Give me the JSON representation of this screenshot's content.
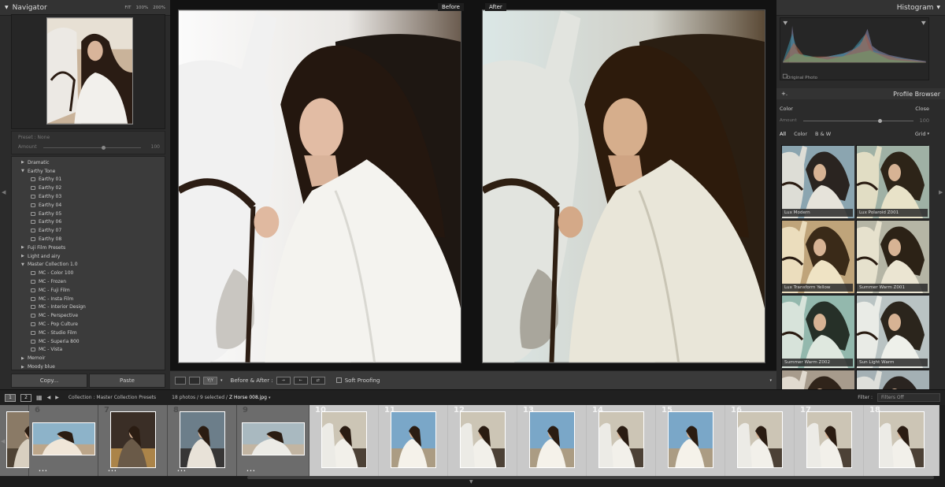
{
  "left_panel": {
    "navigator_title": "Navigator",
    "zoom_options": [
      "FIT",
      "100%",
      "200%"
    ],
    "preset_label": "Preset : None",
    "amount_label": "Amount",
    "amount_value": "100",
    "amount_fraction": 0.6,
    "presets": [
      {
        "label": "Dramatic",
        "kind": "folder",
        "open": false
      },
      {
        "label": "Earthy Tone",
        "kind": "folder",
        "open": true
      },
      {
        "label": "Earthy 01",
        "kind": "preset"
      },
      {
        "label": "Earthy 02",
        "kind": "preset"
      },
      {
        "label": "Earthy 03",
        "kind": "preset"
      },
      {
        "label": "Earthy 04",
        "kind": "preset"
      },
      {
        "label": "Earthy 05",
        "kind": "preset"
      },
      {
        "label": "Earthy 06",
        "kind": "preset"
      },
      {
        "label": "Earthy 07",
        "kind": "preset"
      },
      {
        "label": "Earthy 08",
        "kind": "preset"
      },
      {
        "label": "Fuji Film Presets",
        "kind": "folder",
        "open": false
      },
      {
        "label": "Light and airy",
        "kind": "folder",
        "open": false
      },
      {
        "label": "Master Collection 1.0",
        "kind": "folder",
        "open": true
      },
      {
        "label": "MC - Color 100",
        "kind": "preset"
      },
      {
        "label": "MC - Frozen",
        "kind": "preset"
      },
      {
        "label": "MC - Fuji Film",
        "kind": "preset"
      },
      {
        "label": "MC - Insta Film",
        "kind": "preset"
      },
      {
        "label": "MC - Interior Design",
        "kind": "preset"
      },
      {
        "label": "MC - Perspective",
        "kind": "preset"
      },
      {
        "label": "MC - Pop Culture",
        "kind": "preset"
      },
      {
        "label": "MC - Studio Film",
        "kind": "preset"
      },
      {
        "label": "MC - Superia 800",
        "kind": "preset"
      },
      {
        "label": "MC - Vista",
        "kind": "preset"
      },
      {
        "label": "Memoir",
        "kind": "folder",
        "open": false
      },
      {
        "label": "Moody blue",
        "kind": "folder",
        "open": false
      }
    ],
    "copy_label": "Copy...",
    "paste_label": "Paste"
  },
  "center": {
    "before_label": "Before",
    "after_label": "After",
    "toolbar": {
      "before_after_label": "Before & After :",
      "soft_proofing_label": "Soft Proofing",
      "yy_label": "Y|Y"
    }
  },
  "right_panel": {
    "histogram_title": "Histogram",
    "original_photo_label": "Original Photo",
    "profile_browser_title": "Profile Browser",
    "plus_label": "+.",
    "color_label": "Color",
    "close_label": "Close",
    "amount_label": "Amount",
    "amount_value": "100",
    "amount_fraction": 0.68,
    "filters": [
      "All",
      "Color",
      "B & W"
    ],
    "grid_label": "Grid",
    "profiles": [
      "Lux Modern",
      "Lux Polaroid Z001",
      "Lux Transform Yellow",
      "Summer Warm Z001",
      "Summer Warm Z002",
      "Sun Light Warm",
      "",
      ""
    ]
  },
  "filmstrip_bar": {
    "monitors": [
      "1",
      "2"
    ],
    "collection_text": "Collection : Master Collection Presets",
    "count_text": "18 photos / 9 selected /",
    "filename": "Z Horse 008.jpg",
    "filter_label": "Filter :",
    "filter_value": "Filters Off"
  },
  "filmstrip": [
    {
      "num": "",
      "selected": false,
      "scene": "street"
    },
    {
      "num": "6",
      "selected": false,
      "scene": "picnic"
    },
    {
      "num": "7",
      "selected": false,
      "scene": "night"
    },
    {
      "num": "8",
      "selected": false,
      "scene": "couple"
    },
    {
      "num": "9",
      "selected": false,
      "scene": "car"
    },
    {
      "num": "10",
      "selected": true,
      "scene": "horse"
    },
    {
      "num": "11",
      "selected": true,
      "scene": "sky"
    },
    {
      "num": "12",
      "selected": true,
      "scene": "horse"
    },
    {
      "num": "13",
      "selected": true,
      "scene": "sky"
    },
    {
      "num": "14",
      "selected": true,
      "scene": "horse"
    },
    {
      "num": "15",
      "selected": true,
      "scene": "sky"
    },
    {
      "num": "16",
      "selected": true,
      "scene": "horse"
    },
    {
      "num": "17",
      "selected": true,
      "scene": "horse"
    },
    {
      "num": "18",
      "selected": true,
      "scene": "horse"
    }
  ],
  "colors": {
    "panel_bg": "#2b2b2b",
    "selected_cell": "#c9c9c9",
    "unselected_cell": "#6c6c6c",
    "accent_text": "#ffffff"
  }
}
